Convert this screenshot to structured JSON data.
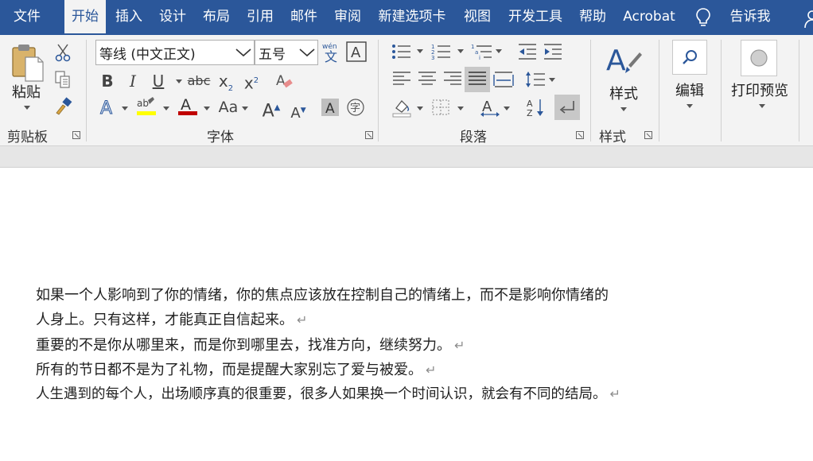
{
  "tabs": {
    "file": "文件",
    "home": "开始",
    "insert": "插入",
    "design": "设计",
    "layout": "布局",
    "references": "引用",
    "mailings": "邮件",
    "review": "审阅",
    "new_tab": "新建选项卡",
    "view": "视图",
    "developer": "开发工具",
    "help": "帮助",
    "acrobat": "Acrobat",
    "tell_me": "告诉我"
  },
  "clipboard": {
    "paste_label": "粘贴",
    "group_label": "剪贴板"
  },
  "font": {
    "name": "等线 (中文正文)",
    "size": "五号",
    "group_label": "字体",
    "bold": "B",
    "italic": "I",
    "underline": "U",
    "strike": "abc",
    "subscript": "x",
    "superscript": "x",
    "case": "Aa",
    "grow": "A",
    "shrink": "A"
  },
  "paragraph": {
    "group_label": "段落"
  },
  "styles": {
    "button_label": "样式",
    "group_label": "样式"
  },
  "editing": {
    "button_label": "编辑"
  },
  "print_preview": {
    "button_label": "打印预览"
  },
  "colors": {
    "ribbon_blue": "#2b579a",
    "highlight": "#ffff00",
    "font_color": "#c00000"
  },
  "document": {
    "paragraphs": [
      "如果一个人影响到了你的情绪，你的焦点应该放在控制自己的情绪上，而不是影响你情绪的",
      "人身上。只有这样，才能真正自信起来。",
      "重要的不是你从哪里来，而是你到哪里去，找准方向，继续努力。",
      "所有的节日都不是为了礼物，而是提醒大家别忘了爱与被爱。",
      "人生遇到的每个人，出场顺序真的很重要，很多人如果换一个时间认识，就会有不同的结局。"
    ],
    "return_mark": "↵"
  }
}
